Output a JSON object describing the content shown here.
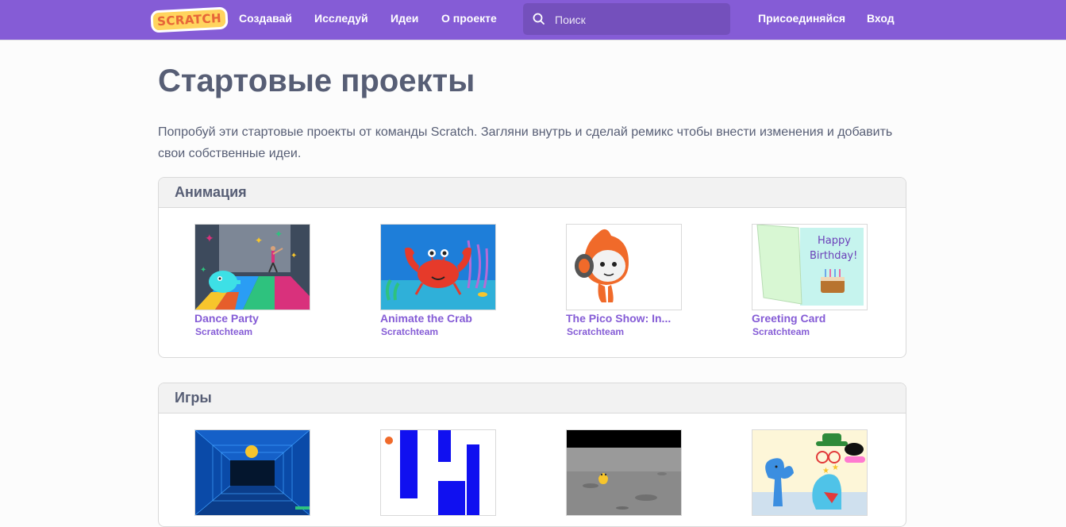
{
  "navbar": {
    "logo_text": "SCRATCH",
    "links": [
      "Создавай",
      "Исследуй",
      "Идеи",
      "О проекте"
    ],
    "search_placeholder": "Поиск",
    "join_label": "Присоединяйся",
    "signin_label": "Вход"
  },
  "page": {
    "title": "Стартовые проекты",
    "intro": "Попробуй эти стартовые проекты от команды Scratch. Загляни внутрь и сделай ремикс чтобы внести изменения и добавить свои собственные идеи."
  },
  "sections": [
    {
      "title": "Анимация",
      "projects": [
        {
          "title": "Dance Party",
          "author": "Scratchteam"
        },
        {
          "title": "Animate the Crab",
          "author": "Scratchteam"
        },
        {
          "title": "The Pico Show: In...",
          "author": "Scratchteam"
        },
        {
          "title": "Greeting Card",
          "author": "Scratchteam"
        }
      ]
    },
    {
      "title": "Игры",
      "projects": [
        {
          "title": "",
          "author": ""
        },
        {
          "title": "",
          "author": ""
        },
        {
          "title": "",
          "author": ""
        },
        {
          "title": "",
          "author": ""
        }
      ]
    }
  ],
  "colors": {
    "brand_purple": "#855cd6",
    "text": "#575e75"
  }
}
